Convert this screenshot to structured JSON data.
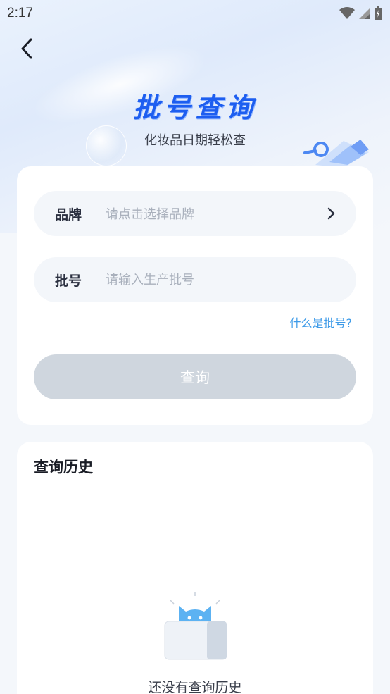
{
  "status_bar": {
    "time": "2:17"
  },
  "header": {
    "title": "批号查询",
    "subtitle": "化妆品日期轻松查"
  },
  "form": {
    "brand_label": "品牌",
    "brand_placeholder": "请点击选择品牌",
    "batch_label": "批号",
    "batch_placeholder": "请输入生产批号",
    "help_link": "什么是批号?",
    "query_button": "查询"
  },
  "history": {
    "title": "查询历史",
    "empty_text": "还没有查询历史"
  },
  "icons": {
    "back": "back-arrow-icon",
    "chevron": "chevron-right-icon",
    "wifi": "wifi-icon",
    "signal": "signal-icon",
    "battery": "battery-icon"
  },
  "colors": {
    "title_blue": "#1d5ef0",
    "link_blue": "#3c9ae8",
    "disabled_button": "#cfd6de",
    "field_bg": "#f3f6fa"
  }
}
